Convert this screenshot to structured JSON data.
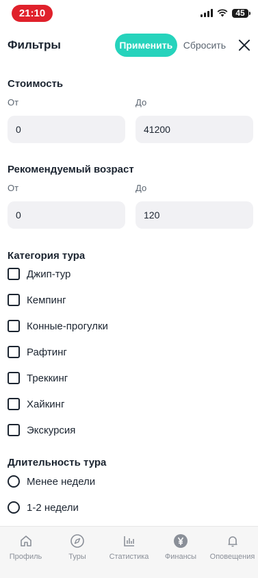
{
  "status": {
    "time": "21:10",
    "battery": "45"
  },
  "header": {
    "title": "Фильтры",
    "apply_label": "Применить",
    "reset_label": "Сбросить"
  },
  "cost": {
    "title": "Стоимость",
    "from_label": "От",
    "to_label": "До",
    "from_value": "0",
    "to_value": "41200"
  },
  "age": {
    "title": "Рекомендуемый возраст",
    "from_label": "От",
    "to_label": "До",
    "from_value": "0",
    "to_value": "120"
  },
  "category": {
    "title": "Категория тура",
    "items": [
      {
        "label": "Джип-тур",
        "checked": false
      },
      {
        "label": "Кемпинг",
        "checked": false
      },
      {
        "label": "Конные-прогулки",
        "checked": false
      },
      {
        "label": "Рафтинг",
        "checked": false
      },
      {
        "label": "Треккинг",
        "checked": false
      },
      {
        "label": "Хайкинг",
        "checked": false
      },
      {
        "label": "Экскурсия",
        "checked": false
      }
    ]
  },
  "duration": {
    "title": "Длительность тура",
    "options": [
      {
        "label": "Менее недели",
        "selected": false
      },
      {
        "label": "1-2 недели",
        "selected": false
      }
    ]
  },
  "tabbar": {
    "items": [
      {
        "label": "Профиль",
        "icon": "home-icon"
      },
      {
        "label": "Туры",
        "icon": "compass-icon"
      },
      {
        "label": "Статистика",
        "icon": "bar-chart-icon"
      },
      {
        "label": "Финансы",
        "icon": "yen-coin-icon"
      },
      {
        "label": "Оповещения",
        "icon": "bell-icon"
      }
    ]
  },
  "colors": {
    "accent": "#26d3bc",
    "time_pill": "#e0212b",
    "input_bg": "#f1f1f4"
  }
}
